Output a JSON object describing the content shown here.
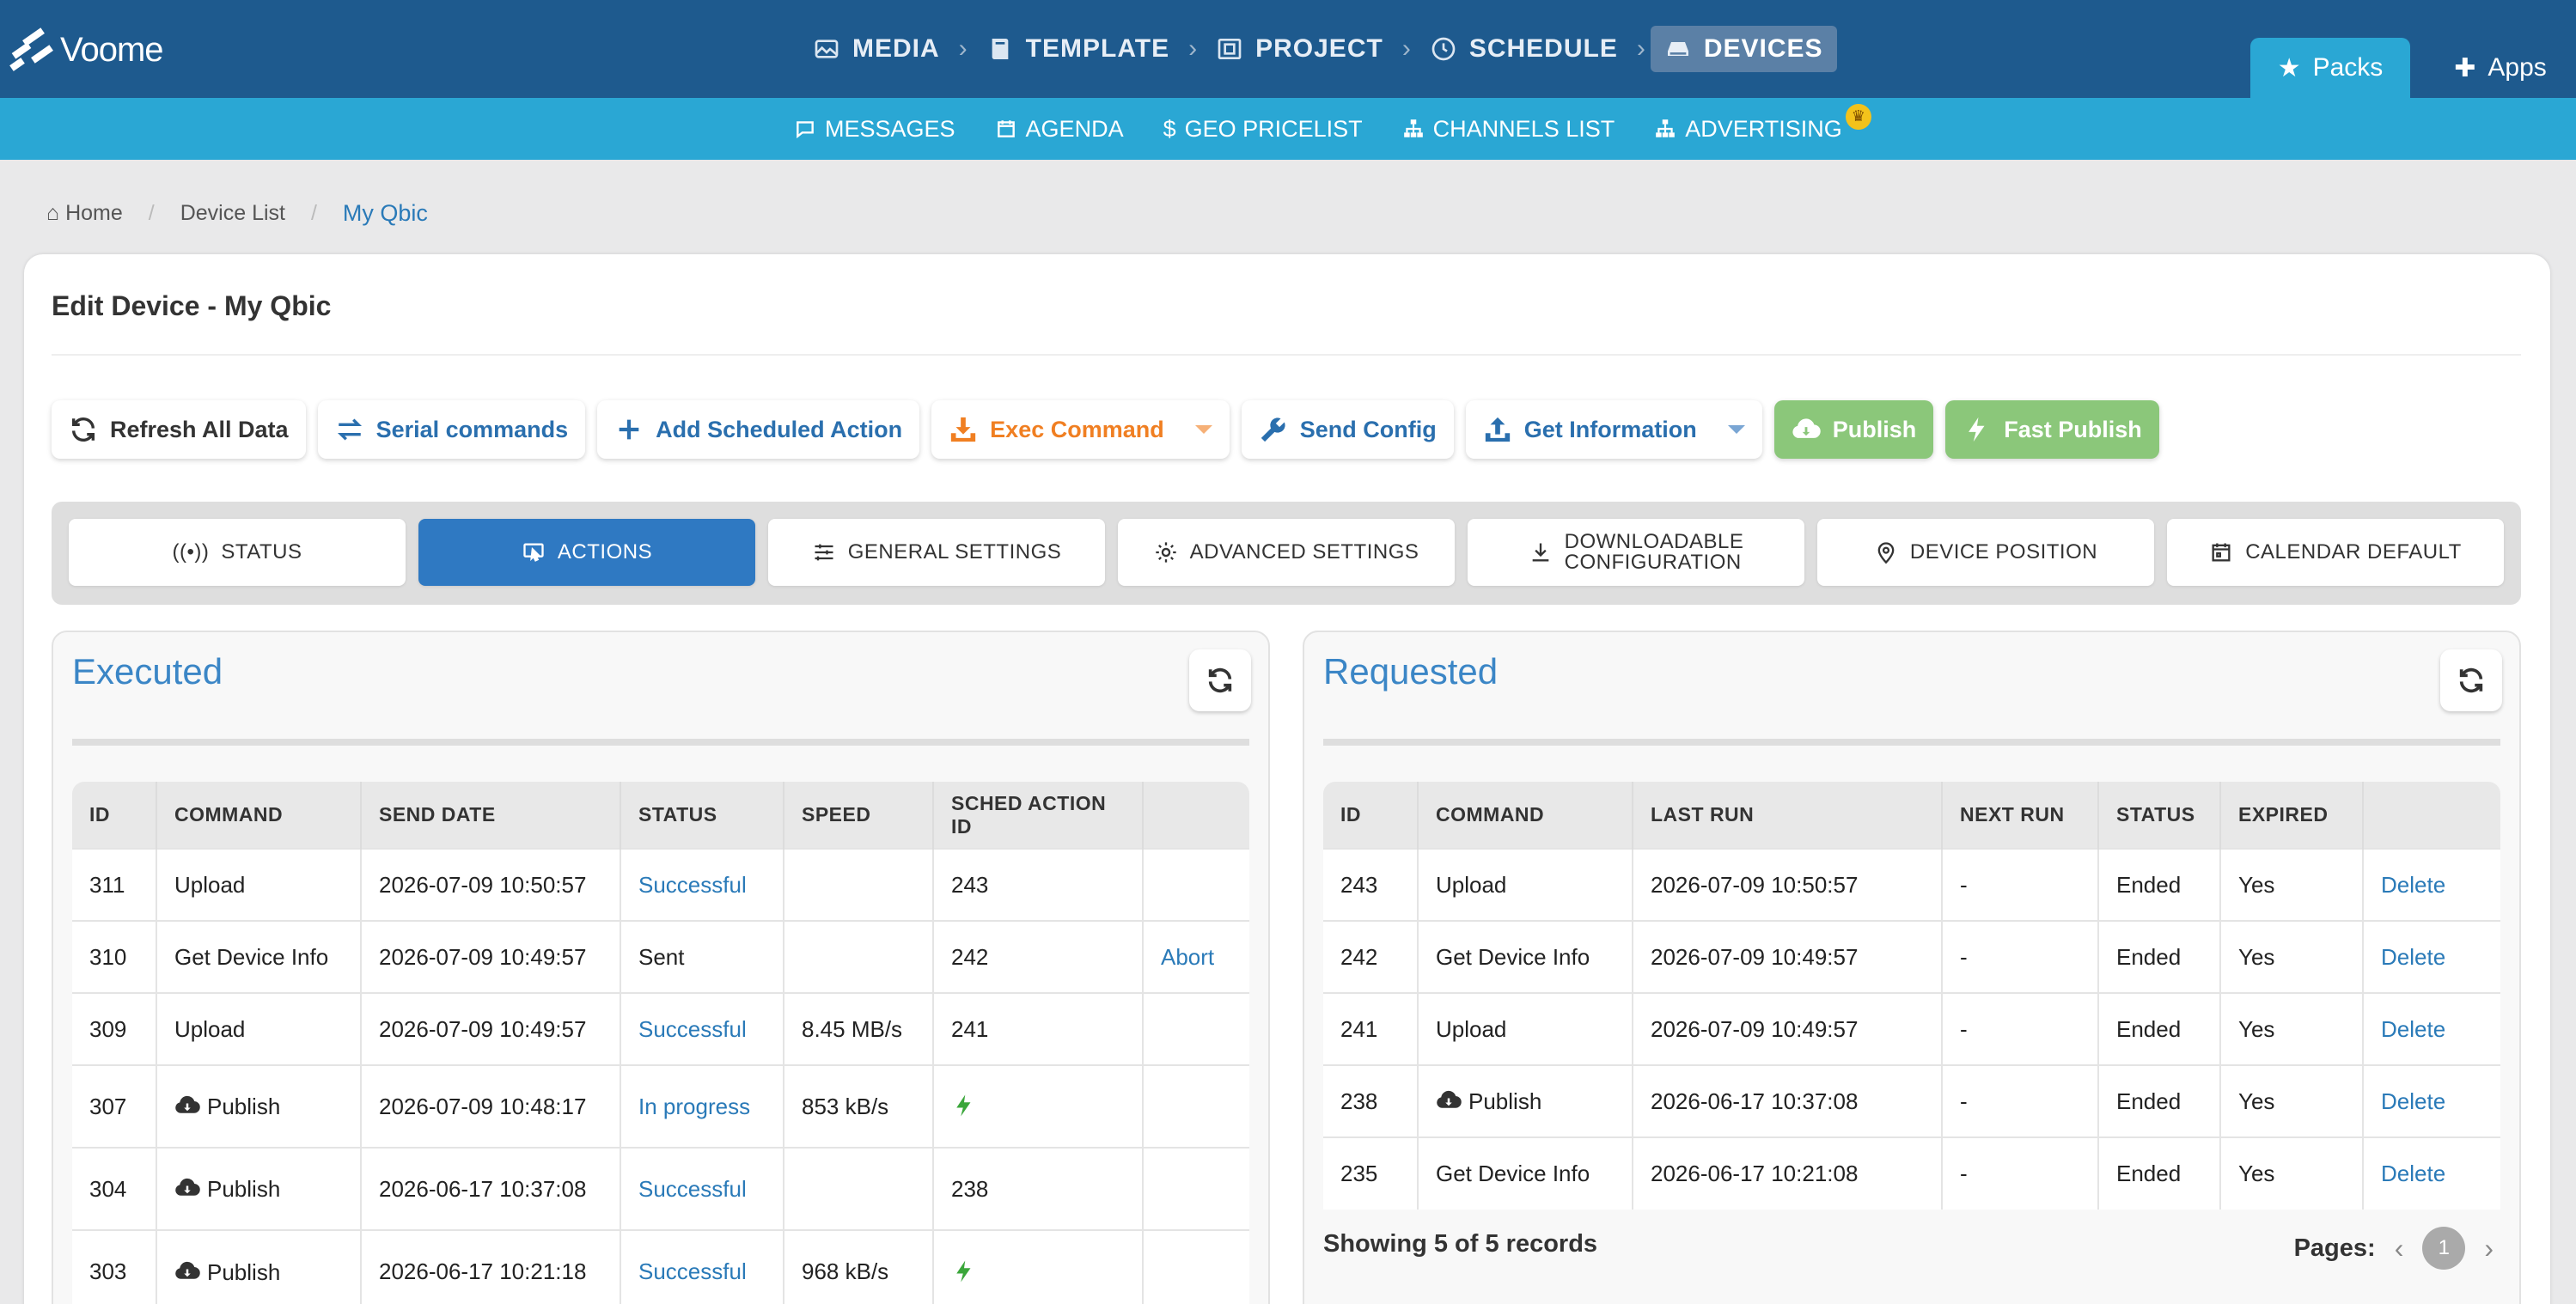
{
  "app": {
    "brand": "Voome"
  },
  "steps": [
    {
      "label": "MEDIA",
      "icon": "image-icon"
    },
    {
      "label": "TEMPLATE",
      "icon": "book-icon"
    },
    {
      "label": "PROJECT",
      "icon": "project-icon"
    },
    {
      "label": "SCHEDULE",
      "icon": "clock-icon"
    },
    {
      "label": "DEVICES",
      "icon": "device-icon",
      "active": true
    }
  ],
  "header_right": {
    "packs": "Packs",
    "apps": "Apps"
  },
  "subnav": [
    "MESSAGES",
    "AGENDA",
    "GEO PRICELIST",
    "CHANNELS LIST",
    "ADVERTISING"
  ],
  "breadcrumb": {
    "home": "Home",
    "list": "Device List",
    "current": "My Qbic"
  },
  "page_title": "Edit Device - My Qbic",
  "toolbar": {
    "refresh": "Refresh All Data",
    "serial": "Serial commands",
    "add": "Add Scheduled Action",
    "exec": "Exec Command",
    "send": "Send Config",
    "info": "Get Information",
    "publish": "Publish",
    "fast": "Fast Publish"
  },
  "tabs": {
    "status": "STATUS",
    "actions": "ACTIONS",
    "general": "GENERAL SETTINGS",
    "advanced": "ADVANCED SETTINGS",
    "download1": "DOWNLOADABLE",
    "download2": "CONFIGURATION",
    "position": "DEVICE POSITION",
    "calendar": "CALENDAR DEFAULT"
  },
  "executed": {
    "title": "Executed",
    "headers": {
      "id": "ID",
      "command": "COMMAND",
      "send_date": "SEND DATE",
      "status": "STATUS",
      "speed": "SPEED",
      "sched": "SCHED ACTION ID"
    },
    "rows": [
      {
        "id": "311",
        "command": "Upload",
        "date": "2026-07-09 10:50:57",
        "status": "Successful",
        "speed": "",
        "sched": "243",
        "action": ""
      },
      {
        "id": "310",
        "command": "Get Device Info",
        "date": "2026-07-09 10:49:57",
        "status": "Sent",
        "speed": "",
        "sched": "242",
        "action": "Abort"
      },
      {
        "id": "309",
        "command": "Upload",
        "date": "2026-07-09 10:49:57",
        "status": "Successful",
        "speed": "8.45 MB/s",
        "sched": "241",
        "action": ""
      },
      {
        "id": "307",
        "command": "Publish",
        "date": "2026-07-09 10:48:17",
        "status": "In progress",
        "speed": "853 kB/s",
        "sched": "",
        "action": ""
      },
      {
        "id": "304",
        "command": "Publish",
        "date": "2026-06-17 10:37:08",
        "status": "Successful",
        "speed": "",
        "sched": "238",
        "action": ""
      },
      {
        "id": "303",
        "command": "Publish",
        "date": "2026-06-17 10:21:18",
        "status": "Successful",
        "speed": "968 kB/s",
        "sched": "",
        "action": ""
      }
    ]
  },
  "requested": {
    "title": "Requested",
    "headers": {
      "id": "ID",
      "command": "COMMAND",
      "last_run": "LAST RUN",
      "next_run": "NEXT RUN",
      "status": "STATUS",
      "expired": "EXPIRED"
    },
    "rows": [
      {
        "id": "243",
        "command": "Upload",
        "last": "2026-07-09 10:50:57",
        "next": "-",
        "status": "Ended",
        "expired": "Yes",
        "action": "Delete"
      },
      {
        "id": "242",
        "command": "Get Device Info",
        "last": "2026-07-09 10:49:57",
        "next": "-",
        "status": "Ended",
        "expired": "Yes",
        "action": "Delete"
      },
      {
        "id": "241",
        "command": "Upload",
        "last": "2026-07-09 10:49:57",
        "next": "-",
        "status": "Ended",
        "expired": "Yes",
        "action": "Delete"
      },
      {
        "id": "238",
        "command": "Publish",
        "last": "2026-06-17 10:37:08",
        "next": "-",
        "status": "Ended",
        "expired": "Yes",
        "action": "Delete"
      },
      {
        "id": "235",
        "command": "Get Device Info",
        "last": "2026-06-17 10:21:08",
        "next": "-",
        "status": "Ended",
        "expired": "Yes",
        "action": "Delete"
      }
    ],
    "showing": "Showing 5 of 5 records",
    "pages_label": "Pages:",
    "page": "1"
  },
  "colors": {
    "header": "#1e5a8e",
    "subbar": "#2aa7d4",
    "accent": "#2f79c2",
    "orange": "#f07f22",
    "green": "#8bc77a",
    "bolt": "#3aa63a"
  }
}
